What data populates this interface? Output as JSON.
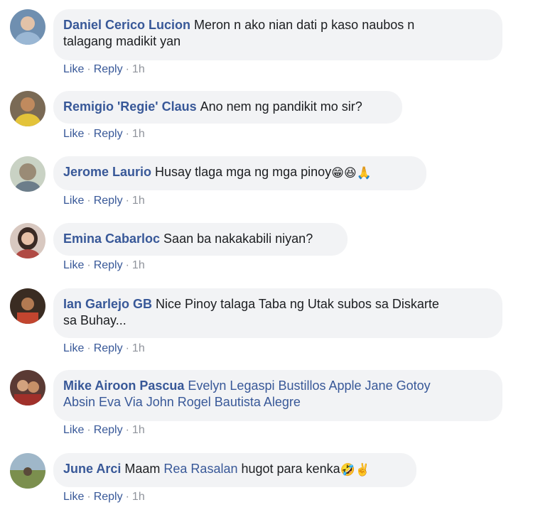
{
  "comments": [
    {
      "author": "Daniel Cerico Lucion",
      "text_line1": "Meron n ako nian dati p kaso naubos n",
      "text_line2": "talagang madikit yan",
      "like": "Like",
      "reply": "Reply",
      "time": "1h"
    },
    {
      "author": "Remigio 'Regie' Claus",
      "text": "Ano nem ng pandikit mo sir?",
      "like": "Like",
      "reply": "Reply",
      "time": "1h"
    },
    {
      "author": "Jerome Laurio",
      "text": "Husay tlaga mga ng mga pinoy",
      "emojis": [
        "😁",
        "😆",
        "🙏"
      ],
      "like": "Like",
      "reply": "Reply",
      "time": "1h"
    },
    {
      "author": "Emina Cabarloc",
      "text": "Saan ba nakakabili niyan?",
      "like": "Like",
      "reply": "Reply",
      "time": "1h"
    },
    {
      "author": "Ian Garlejo GB",
      "text_line1": "Nice Pinoy talaga Taba ng Utak subos sa Diskarte",
      "text_line2": "sa Buhay...",
      "like": "Like",
      "reply": "Reply",
      "time": "1h"
    },
    {
      "author": "Mike Airoon Pascua",
      "mentions_line1": "Evelyn Legaspi Bustillos Apple Jane Gotoy",
      "mentions_line2": "Absin Eva Via John Rogel Bautista Alegre",
      "like": "Like",
      "reply": "Reply",
      "time": "1h"
    },
    {
      "author": "June Arci",
      "text_pre": "Maam",
      "mention": "Rea Rasalan",
      "text_post": "hugot para kenka",
      "emojis": [
        "🤣",
        "✌️"
      ],
      "like": "Like",
      "reply": "Reply",
      "time": "1h"
    }
  ],
  "separator": "·",
  "colors": {
    "link": "#385898",
    "bubble": "#f2f3f5",
    "meta": "#90949c"
  }
}
